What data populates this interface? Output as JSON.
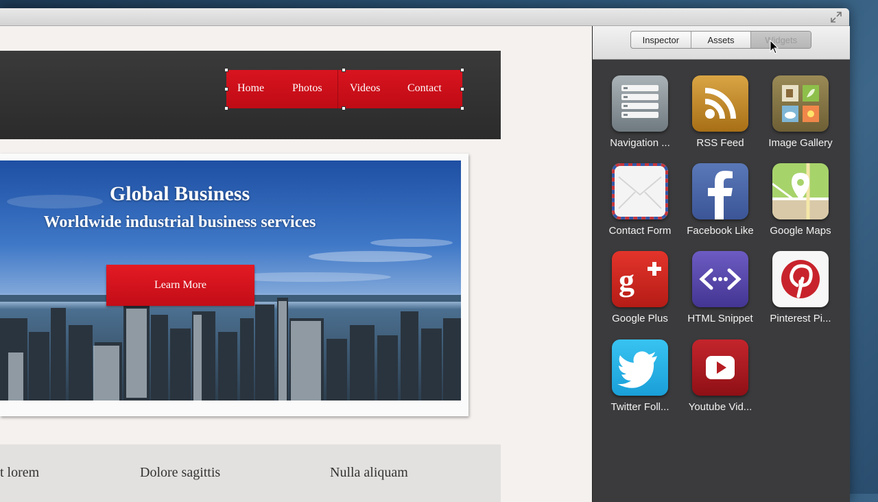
{
  "site": {
    "nav": [
      "Home",
      "Photos",
      "Videos",
      "Contact"
    ],
    "hero": {
      "title": "Global Business",
      "subtitle": "Worldwide industrial business services",
      "button": "Learn More"
    },
    "columns": [
      "t lorem",
      "Dolore sagittis",
      "Nulla aliquam"
    ]
  },
  "panel": {
    "tabs": [
      {
        "label": "Inspector",
        "active": false
      },
      {
        "label": "Assets",
        "active": false
      },
      {
        "label": "Widgets",
        "active": true
      }
    ],
    "widgets": [
      {
        "label": "Navigation ...",
        "icon": "navigation-icon"
      },
      {
        "label": "RSS Feed",
        "icon": "rss-icon"
      },
      {
        "label": "Image Gallery",
        "icon": "image-gallery-icon"
      },
      {
        "label": "Contact Form",
        "icon": "envelope-icon"
      },
      {
        "label": "Facebook Like",
        "icon": "facebook-icon"
      },
      {
        "label": "Google Maps",
        "icon": "map-pin-icon"
      },
      {
        "label": "Google Plus",
        "icon": "google-plus-icon"
      },
      {
        "label": "HTML Snippet",
        "icon": "code-icon"
      },
      {
        "label": "Pinterest Pi...",
        "icon": "pinterest-icon"
      },
      {
        "label": "Twitter Foll...",
        "icon": "twitter-bird-icon"
      },
      {
        "label": "Youtube Vid...",
        "icon": "play-icon"
      }
    ]
  },
  "colors": {
    "accent_red": "#d8141f",
    "panel_bg": "#3b3b3d",
    "header_bg": "#2f2f2f"
  }
}
